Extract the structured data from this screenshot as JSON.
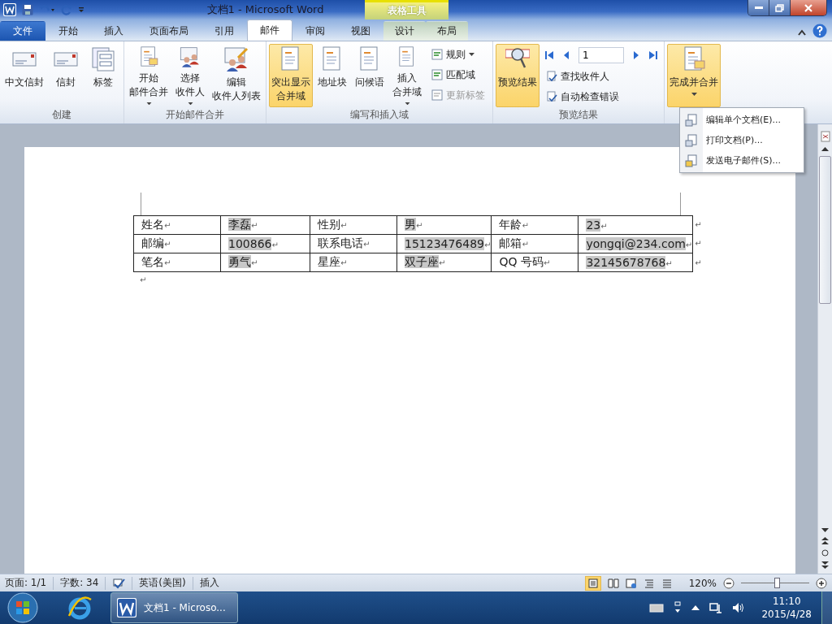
{
  "window": {
    "title": "文档1  -  Microsoft Word",
    "context_tab": "表格工具"
  },
  "tabs": [
    {
      "label": "文件",
      "kind": "file",
      "selected": false
    },
    {
      "label": "开始",
      "kind": "normal",
      "selected": false
    },
    {
      "label": "插入",
      "kind": "normal",
      "selected": false
    },
    {
      "label": "页面布局",
      "kind": "normal",
      "selected": false
    },
    {
      "label": "引用",
      "kind": "normal",
      "selected": false
    },
    {
      "label": "邮件",
      "kind": "normal",
      "selected": true
    },
    {
      "label": "审阅",
      "kind": "normal",
      "selected": false
    },
    {
      "label": "视图",
      "kind": "normal",
      "selected": false
    },
    {
      "label": "设计",
      "kind": "contextual",
      "selected": false
    },
    {
      "label": "布局",
      "kind": "contextual",
      "selected": false
    }
  ],
  "ribbon": [
    {
      "name": "创建",
      "items": [
        {
          "kind": "large",
          "lines": [
            "中文信封"
          ],
          "highlighted": false,
          "dropdown": false
        },
        {
          "kind": "large",
          "lines": [
            "信封"
          ],
          "highlighted": false,
          "dropdown": false
        },
        {
          "kind": "large",
          "lines": [
            "标签"
          ],
          "highlighted": false,
          "dropdown": false
        }
      ]
    },
    {
      "name": "开始邮件合并",
      "items": [
        {
          "kind": "large",
          "lines": [
            "开始",
            "邮件合并"
          ],
          "highlighted": false,
          "dropdown": true
        },
        {
          "kind": "large",
          "lines": [
            "选择",
            "收件人"
          ],
          "highlighted": false,
          "dropdown": true
        },
        {
          "kind": "large",
          "lines": [
            "编辑",
            "收件人列表"
          ],
          "highlighted": false,
          "dropdown": false
        }
      ]
    },
    {
      "name": "编写和插入域",
      "items": [
        {
          "kind": "large",
          "lines": [
            "突出显示",
            "合并域"
          ],
          "highlighted": true,
          "dropdown": false
        },
        {
          "kind": "large",
          "lines": [
            "地址块"
          ],
          "highlighted": false,
          "dropdown": false
        },
        {
          "kind": "large",
          "lines": [
            "问候语"
          ],
          "highlighted": false,
          "dropdown": false
        },
        {
          "kind": "large",
          "lines": [
            "插入",
            "合并域"
          ],
          "highlighted": false,
          "dropdown": true
        },
        {
          "kind": "small",
          "buttons": [
            {
              "label": "规则",
              "dropdown": true,
              "disabled": false
            },
            {
              "label": "匹配域",
              "dropdown": false,
              "disabled": false
            },
            {
              "label": "更新标签",
              "dropdown": false,
              "disabled": true
            }
          ]
        }
      ]
    },
    {
      "name": "预览结果",
      "items": [
        {
          "kind": "large",
          "lines": [
            "预览结果"
          ],
          "highlighted": true,
          "dropdown": false
        },
        {
          "kind": "nav",
          "record": "1",
          "buttons": [
            {
              "label": "查找收件人",
              "disabled": false
            },
            {
              "label": "自动检查错误",
              "disabled": false
            }
          ]
        }
      ]
    },
    {
      "items": [
        {
          "kind": "large",
          "lines": [
            "完成并合并"
          ],
          "highlighted": true,
          "dropdown": true
        }
      ]
    }
  ],
  "menu": [
    "编辑单个文档(E)...",
    "打印文档(P)...",
    "发送电子邮件(S)..."
  ],
  "table": {
    "rows": [
      [
        {
          "text": "姓名",
          "field": false,
          "mark": "↵"
        },
        {
          "text": "李磊",
          "field": true,
          "mark": "↵"
        },
        {
          "text": "性别",
          "field": false,
          "mark": "↵"
        },
        {
          "text": "男",
          "field": true,
          "mark": "↵"
        },
        {
          "text": "年龄",
          "field": false,
          "mark": "↵"
        },
        {
          "text": "23",
          "field": true,
          "mark": "↵"
        }
      ],
      [
        {
          "text": "邮编",
          "field": false,
          "mark": "↵"
        },
        {
          "text": "100866",
          "field": true,
          "mark": "↵"
        },
        {
          "text": "联系电话",
          "field": false,
          "mark": "↵"
        },
        {
          "text": "15123476489",
          "field": true,
          "mark": "↵"
        },
        {
          "text": "邮箱",
          "field": false,
          "mark": "↵"
        },
        {
          "text": "yongqi@234.com",
          "field": true,
          "mark": "↵"
        }
      ],
      [
        {
          "text": "笔名",
          "field": false,
          "mark": "↵"
        },
        {
          "text": "勇气",
          "field": true,
          "mark": "↵"
        },
        {
          "text": "星座",
          "field": false,
          "mark": "↵"
        },
        {
          "text": "双子座",
          "field": true,
          "mark": "↵"
        },
        {
          "text": "QQ 号码",
          "field": false,
          "mark": "↵"
        },
        {
          "text": "32145678768",
          "field": true,
          "mark": "↵"
        }
      ]
    ],
    "row_marks": [
      "↵",
      "↵",
      "↵"
    ],
    "after_mark": "↵"
  },
  "status_bar": {
    "page": "页面: 1/1",
    "words": "字数: 34",
    "language": "英语(美国)",
    "mode": "插入",
    "zoom": "120%",
    "zoom_slider": {
      "level": 0.52
    }
  },
  "taskbar": {
    "task": "文档1 - Microso...",
    "time": "11:10",
    "date": "2015/4/28"
  }
}
